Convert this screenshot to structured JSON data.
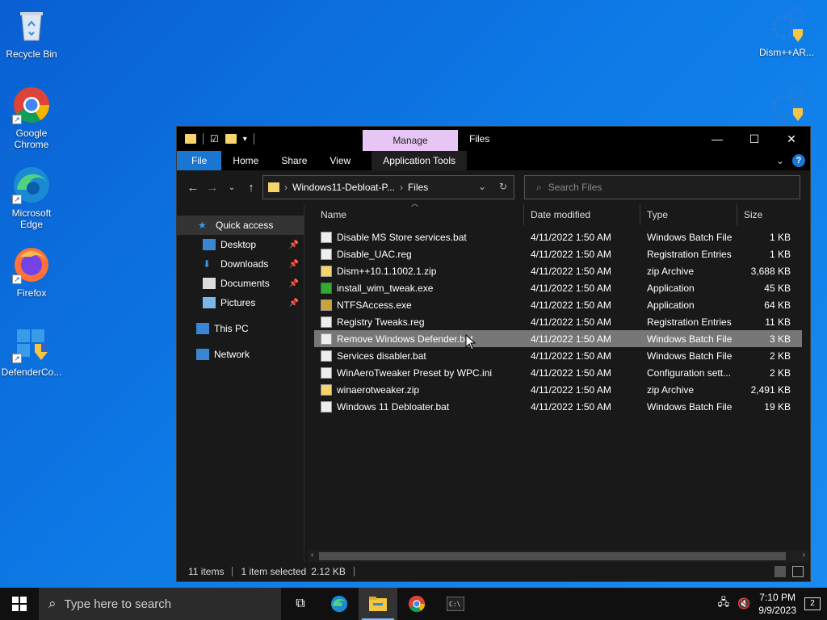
{
  "desktop": {
    "icons_left": [
      {
        "label": "Recycle Bin",
        "icon": "recycle-bin-icon"
      },
      {
        "label": "Google Chrome",
        "icon": "chrome-icon"
      },
      {
        "label": "Microsoft Edge",
        "icon": "edge-icon"
      },
      {
        "label": "Firefox",
        "icon": "firefox-icon"
      },
      {
        "label": "DefenderCo...",
        "icon": "defender-control-icon"
      }
    ],
    "icons_right": [
      {
        "label": "Dism++AR...",
        "icon": "dism-gear-icon"
      },
      {
        "label": "",
        "icon": "dism-gear-icon"
      }
    ]
  },
  "window": {
    "manage_tab": "Manage",
    "title": "Files",
    "ribbon_tabs": [
      "File",
      "Home",
      "Share",
      "View",
      "Application Tools"
    ],
    "address": {
      "path": [
        "Windows11-Debloat-P...",
        "Files"
      ]
    },
    "search_placeholder": "Search Files",
    "nav": {
      "quick_access": "Quick access",
      "items": [
        {
          "label": "Desktop",
          "pinned": true
        },
        {
          "label": "Downloads",
          "pinned": true
        },
        {
          "label": "Documents",
          "pinned": true
        },
        {
          "label": "Pictures",
          "pinned": true
        }
      ],
      "this_pc": "This PC",
      "network": "Network"
    },
    "columns": [
      "Name",
      "Date modified",
      "Type",
      "Size"
    ],
    "files": [
      {
        "name": "Disable MS Store services.bat",
        "date": "4/11/2022 1:50 AM",
        "type": "Windows Batch File",
        "size": "1 KB",
        "icon": "bat"
      },
      {
        "name": "Disable_UAC.reg",
        "date": "4/11/2022 1:50 AM",
        "type": "Registration Entries",
        "size": "1 KB",
        "icon": "reg"
      },
      {
        "name": "Dism++10.1.1002.1.zip",
        "date": "4/11/2022 1:50 AM",
        "type": "zip Archive",
        "size": "3,688 KB",
        "icon": "zip"
      },
      {
        "name": "install_wim_tweak.exe",
        "date": "4/11/2022 1:50 AM",
        "type": "Application",
        "size": "45 KB",
        "icon": "exe"
      },
      {
        "name": "NTFSAccess.exe",
        "date": "4/11/2022 1:50 AM",
        "type": "Application",
        "size": "64 KB",
        "icon": "lock"
      },
      {
        "name": "Registry Tweaks.reg",
        "date": "4/11/2022 1:50 AM",
        "type": "Registration Entries",
        "size": "11 KB",
        "icon": "reg"
      },
      {
        "name": "Remove Windows Defender.bat",
        "date": "4/11/2022 1:50 AM",
        "type": "Windows Batch File",
        "size": "3 KB",
        "icon": "bat",
        "selected": true
      },
      {
        "name": "Services disabler.bat",
        "date": "4/11/2022 1:50 AM",
        "type": "Windows Batch File",
        "size": "2 KB",
        "icon": "bat"
      },
      {
        "name": "WinAeroTweaker Preset by WPC.ini",
        "date": "4/11/2022 1:50 AM",
        "type": "Configuration sett...",
        "size": "2 KB",
        "icon": "ini"
      },
      {
        "name": "winaerotweaker.zip",
        "date": "4/11/2022 1:50 AM",
        "type": "zip Archive",
        "size": "2,491 KB",
        "icon": "zip"
      },
      {
        "name": "Windows 11 Debloater.bat",
        "date": "4/11/2022 1:50 AM",
        "type": "Windows Batch File",
        "size": "19 KB",
        "icon": "bat"
      }
    ],
    "status": {
      "items": "11 items",
      "selected": "1 item selected",
      "size": "2.12 KB"
    }
  },
  "taskbar": {
    "search_placeholder": "Type here to search",
    "time": "7:10 PM",
    "date": "9/9/2023",
    "notification_count": "2"
  }
}
